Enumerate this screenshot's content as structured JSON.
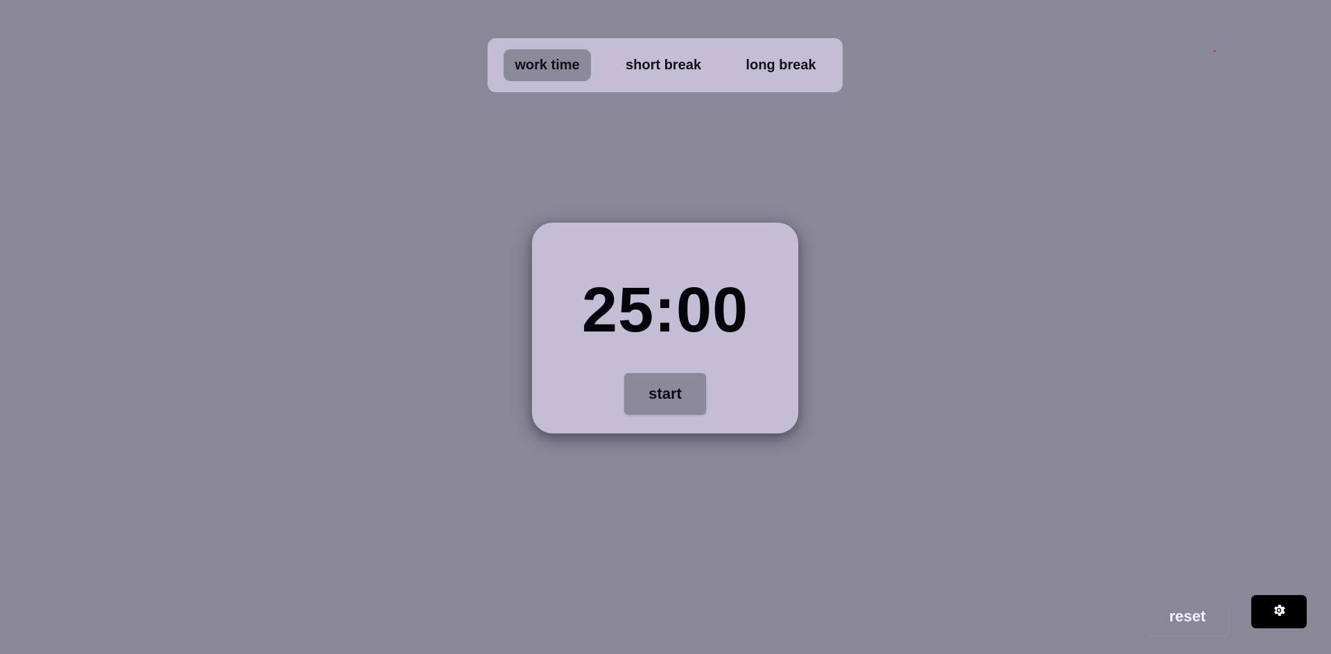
{
  "modes": {
    "tabs": [
      {
        "label": "work time",
        "active": true
      },
      {
        "label": "short break",
        "active": false
      },
      {
        "label": "long break",
        "active": false
      }
    ]
  },
  "timer": {
    "display": "25:00",
    "start_label": "start"
  },
  "controls": {
    "reset_label": "reset",
    "settings_icon": "gear-icon"
  },
  "colors": {
    "background": "#8a8799",
    "panel": "#c3bdd5",
    "active_tab": "#8c899b",
    "settings_button": "#000000",
    "indicator_dot": "#e0203a"
  }
}
